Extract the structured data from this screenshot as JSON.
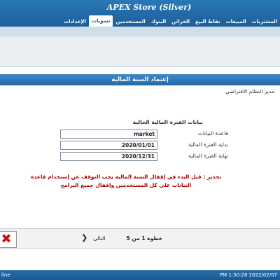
{
  "header": {
    "app_title": "APEX Store (Silver)",
    "menu": [
      {
        "label": "المشتريات",
        "active": false
      },
      {
        "label": "المبيعات",
        "active": false
      },
      {
        "label": "نقاط البيع",
        "active": false
      },
      {
        "label": "الخزائن",
        "active": false
      },
      {
        "label": "البنوك",
        "active": false
      },
      {
        "label": "المستخدمين",
        "active": false
      },
      {
        "label": "تسويات",
        "active": true
      },
      {
        "label": "الإعدادات",
        "active": false
      }
    ]
  },
  "page": {
    "title": "إعتماد السنة المالية",
    "user_label": "مدير النظام الافتراضي"
  },
  "form": {
    "group_title": "بيانات الفترة المالية الحالية",
    "database_label": "قاعدة البيانات",
    "database_value": "market",
    "start_label": "بداية الفترة المالية",
    "start_value": "2020/01/01",
    "end_label": "نهاية الفترة المالية",
    "end_value": "2020/12/31"
  },
  "warning": {
    "text": "تحذير : قبل البدء في إقفال السنة المالية يجب التوقف عن إستخدام قاعدة البيانات على كل المستخدمين وإقفال جميع البرامج"
  },
  "wizard": {
    "step_label": "خطوة 1 من 5",
    "next_label": "التالى",
    "next_icon": "chevron-right-icon",
    "close_icon": "close-x-icon"
  },
  "status": {
    "left_text": "line",
    "right_text": "PM 1:50:28 2022/02/07"
  },
  "colors": {
    "header_blue": "#1d5f98",
    "warning_red": "#a80000",
    "close_red": "#cc1111"
  }
}
